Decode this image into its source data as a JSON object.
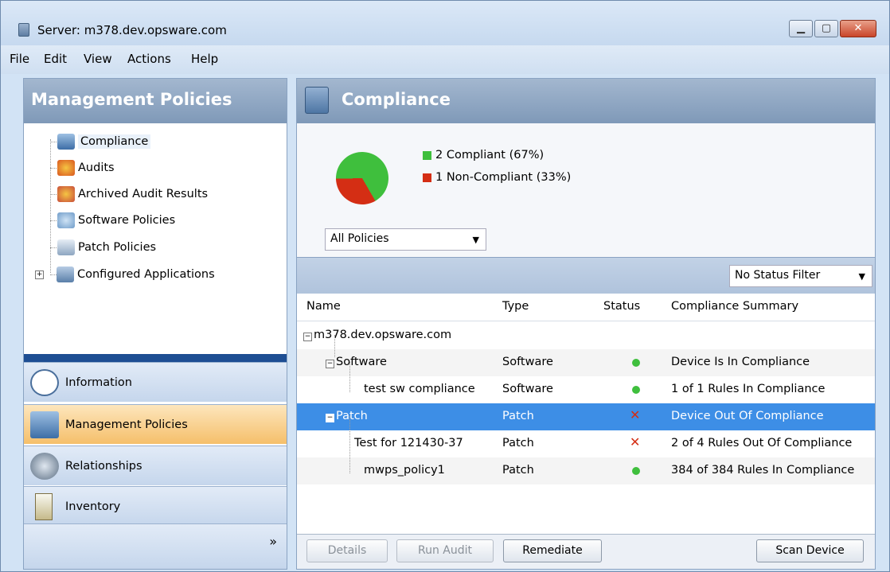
{
  "window": {
    "title": "Server: m378.dev.opsware.com"
  },
  "menu": [
    "File",
    "Edit",
    "View",
    "Actions",
    "Help"
  ],
  "left_panel": {
    "title": "Management Policies",
    "tree": [
      {
        "label": "Compliance",
        "icon": "compliance-icon"
      },
      {
        "label": "Audits",
        "icon": "audit-icon"
      },
      {
        "label": "Archived Audit Results",
        "icon": "archived-audit-icon"
      },
      {
        "label": "Software Policies",
        "icon": "software-policy-icon"
      },
      {
        "label": "Patch Policies",
        "icon": "patch-policy-icon"
      },
      {
        "label": "Configured Applications",
        "icon": "configured-apps-icon"
      }
    ],
    "nav": [
      {
        "label": "Information",
        "icon": "speech-bubble-icon"
      },
      {
        "label": "Management Policies",
        "icon": "management-policies-icon",
        "selected": true
      },
      {
        "label": "Relationships",
        "icon": "relationships-icon"
      },
      {
        "label": "Inventory",
        "icon": "clipboard-icon"
      }
    ],
    "expand_glyph": "»"
  },
  "right_panel": {
    "title": "Compliance",
    "legend": [
      {
        "label": "2 Compliant (67%)",
        "color": "#3fbf3d"
      },
      {
        "label": "1 Non-Compliant (33%)",
        "color": "#d42e14"
      }
    ],
    "policy_filter": "All Policies",
    "status_filter": "No Status Filter",
    "columns": [
      "Name",
      "Type",
      "Status",
      "Compliance Summary"
    ],
    "root": "m378.dev.opsware.com",
    "rows": [
      {
        "name": "Software",
        "type": "Software",
        "status": "compliant",
        "summary": "Device Is In Compliance"
      },
      {
        "name": "test sw compliance",
        "type": "Software",
        "status": "compliant",
        "summary": "1 of 1 Rules In Compliance"
      },
      {
        "name": "Patch",
        "type": "Patch",
        "status": "non-compliant",
        "summary": "Device Out Of Compliance"
      },
      {
        "name": "Test for 121430-37",
        "type": "Patch",
        "status": "non-compliant",
        "summary": "2 of 4 Rules Out Of Compliance"
      },
      {
        "name": "mwps_policy1",
        "type": "Patch",
        "status": "compliant",
        "summary": "384 of 384 Rules In Compliance"
      }
    ],
    "buttons": {
      "details": "Details",
      "run_audit": "Run Audit",
      "remediate": "Remediate",
      "scan": "Scan Device"
    }
  },
  "pie": {
    "compliant_pct": 67,
    "noncompliant_pct": 33
  }
}
